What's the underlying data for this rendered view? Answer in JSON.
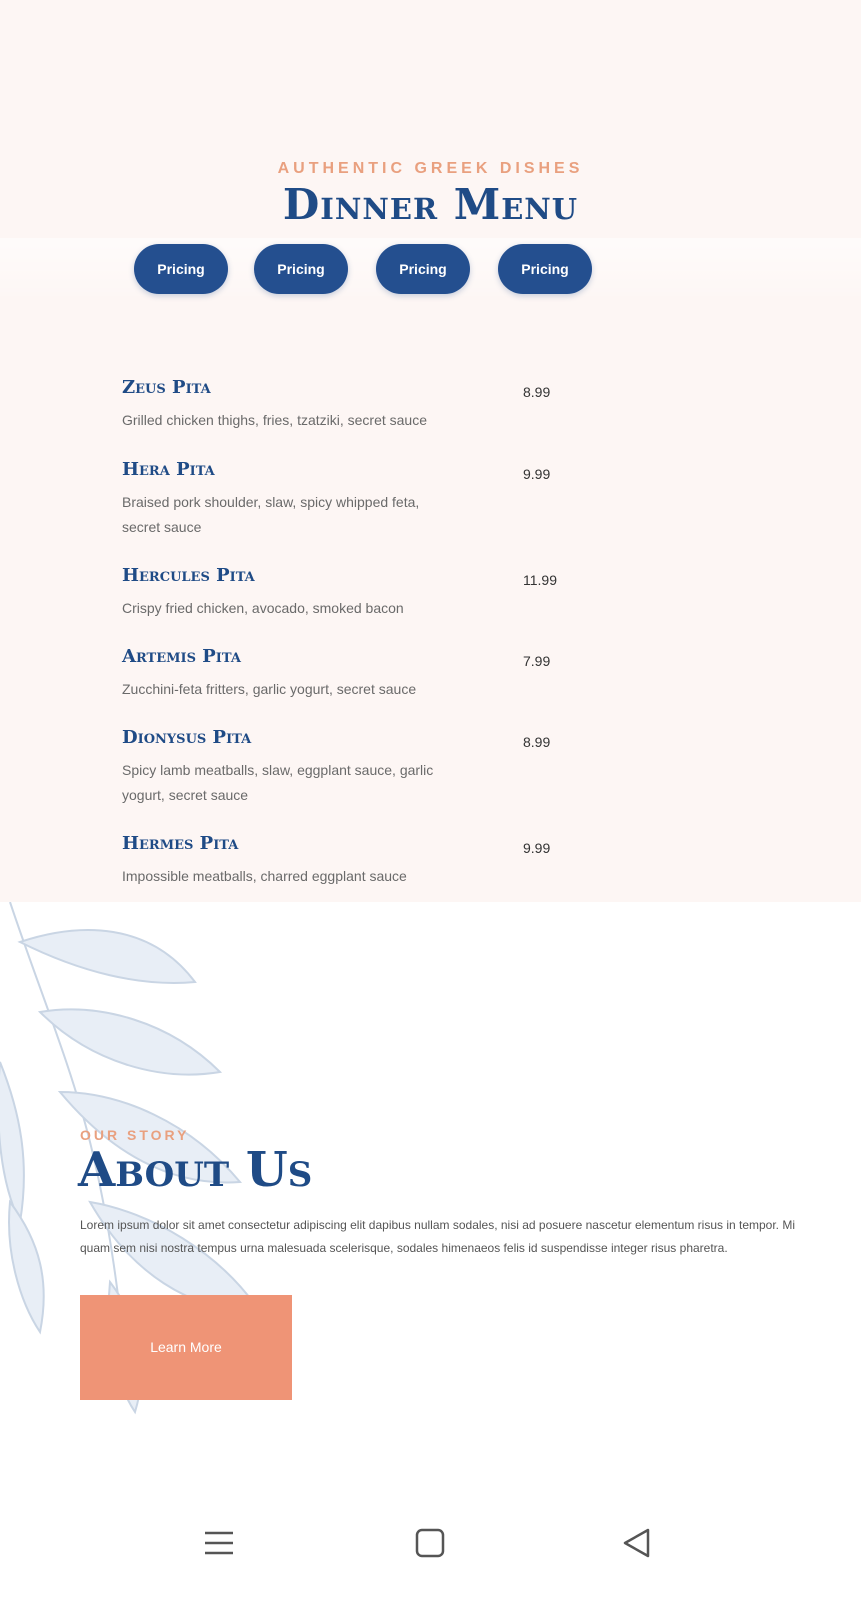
{
  "menu": {
    "eyebrow": "AUTHENTIC GREEK DISHES",
    "title": "Dinner Menu",
    "pills": [
      "Pricing",
      "Pricing",
      "Pricing",
      "Pricing"
    ],
    "items": [
      {
        "name": "Zeus Pita",
        "price": "8.99",
        "description": "Grilled chicken thighs, fries, tzatziki, secret sauce"
      },
      {
        "name": "Hera Pita",
        "price": "9.99",
        "description": "Braised pork shoulder, slaw, spicy whipped feta, secret sauce"
      },
      {
        "name": "Hercules Pita",
        "price": "11.99",
        "description": "Crispy fried chicken, avocado, smoked bacon"
      },
      {
        "name": "Artemis Pita",
        "price": "7.99",
        "description": "Zucchini-feta fritters, garlic yogurt, secret sauce"
      },
      {
        "name": "Dionysus Pita",
        "price": "8.99",
        "description": "Spicy lamb meatballs, slaw, eggplant sauce, garlic yogurt, secret sauce"
      },
      {
        "name": "Hermes Pita",
        "price": "9.99",
        "description": "Impossible meatballs, charred eggplant sauce"
      }
    ]
  },
  "about": {
    "eyebrow": "OUR STORY",
    "title": "About Us",
    "body": "Lorem ipsum dolor sit amet consectetur adipiscing elit dapibus nullam sodales, nisi ad posuere nascetur elementum risus in tempor. Mi quam sem nisi nostra tempus urna malesuada scelerisque, sodales himenaeos felis id suspendisse integer risus pharetra.",
    "button": "Learn More"
  },
  "nav": {
    "icons": [
      "menu-icon",
      "home-icon",
      "back-icon"
    ]
  },
  "colors": {
    "brand_blue": "#1f4b86",
    "accent_peach": "#ef9476",
    "menu_background": "#fdf6f4"
  }
}
